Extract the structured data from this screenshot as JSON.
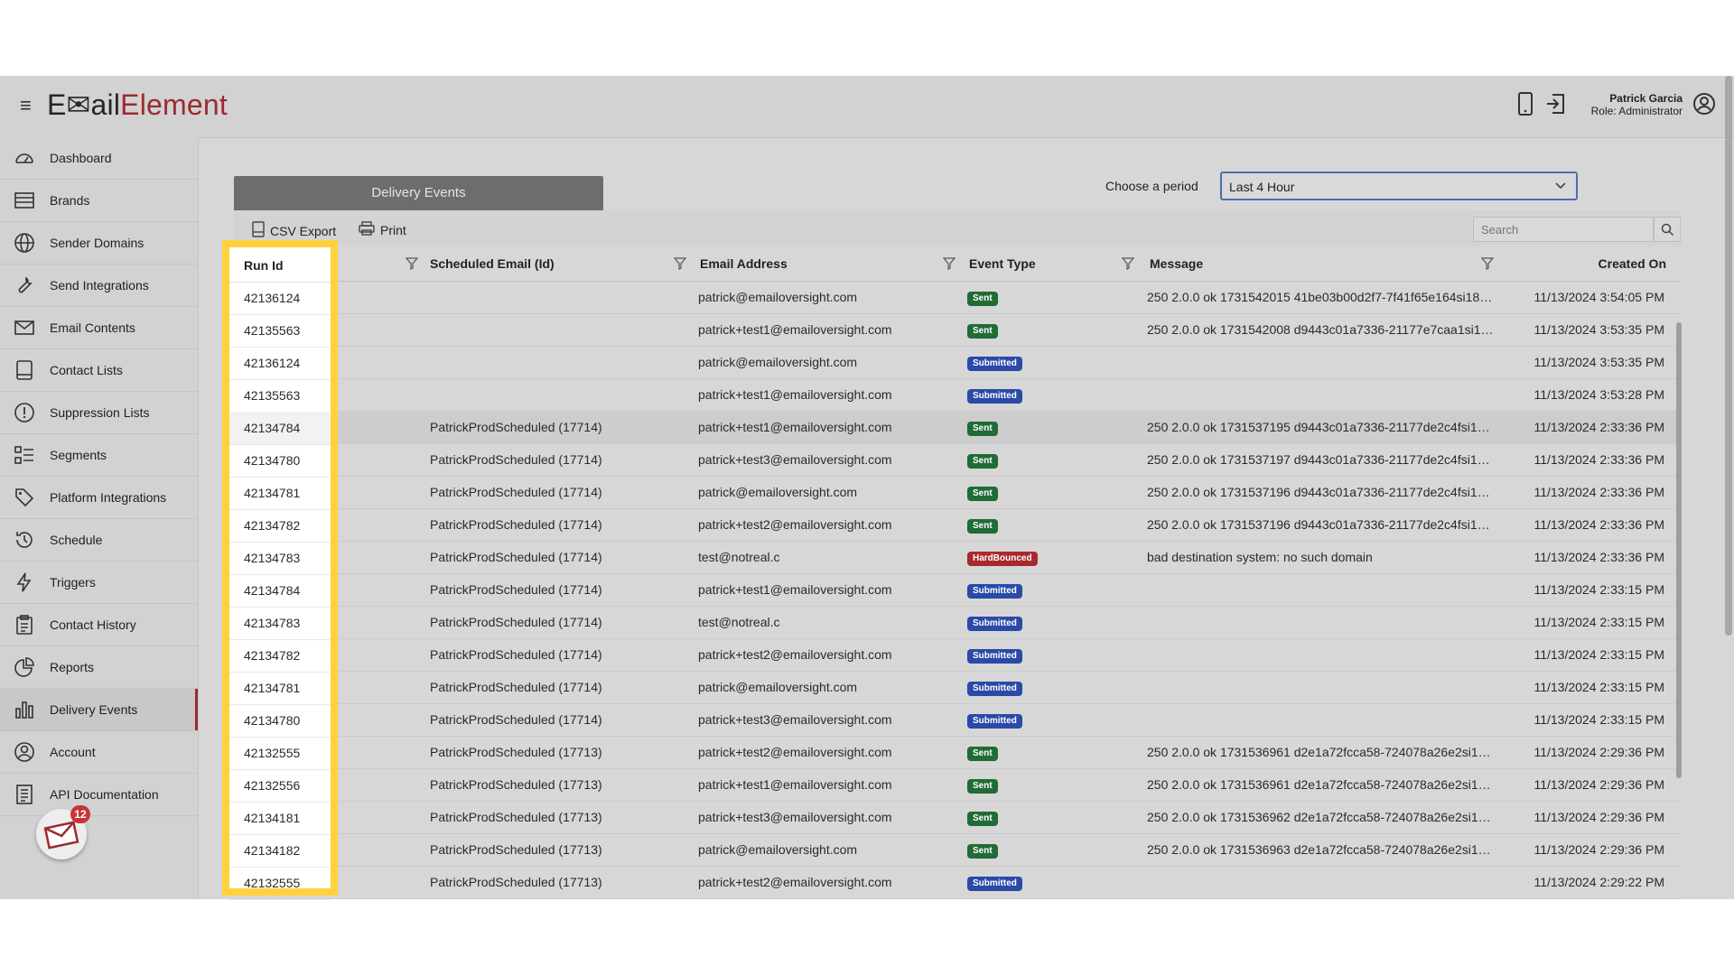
{
  "app": {
    "logo_part1": "E✉ail",
    "logo_part2": "Element"
  },
  "user": {
    "name": "Patrick Garcia",
    "role": "Role: Administrator"
  },
  "sidebar": {
    "items": [
      {
        "label": "Dashboard",
        "icon": "dashboard-icon"
      },
      {
        "label": "Brands",
        "icon": "brands-icon"
      },
      {
        "label": "Sender Domains",
        "icon": "globe-icon"
      },
      {
        "label": "Send Integrations",
        "icon": "wrench-icon"
      },
      {
        "label": "Email Contents",
        "icon": "envelope-icon"
      },
      {
        "label": "Contact Lists",
        "icon": "list-icon"
      },
      {
        "label": "Suppression Lists",
        "icon": "exclamation-icon"
      },
      {
        "label": "Segments",
        "icon": "segments-icon"
      },
      {
        "label": "Platform Integrations",
        "icon": "tag-icon"
      },
      {
        "label": "Schedule",
        "icon": "history-icon"
      },
      {
        "label": "Triggers",
        "icon": "bolt-icon"
      },
      {
        "label": "Contact History",
        "icon": "clipboard-icon"
      },
      {
        "label": "Reports",
        "icon": "pie-chart-icon"
      },
      {
        "label": "Delivery Events",
        "icon": "bar-chart-icon",
        "active": true
      },
      {
        "label": "Account",
        "icon": "user-circle-icon"
      },
      {
        "label": "API Documentation",
        "icon": "document-icon"
      }
    ],
    "notification_count": "12"
  },
  "main": {
    "tab_label": "Delivery Events",
    "period_label": "Choose a period",
    "period_value": "Last 4 Hour",
    "csv_export_label": "CSV Export",
    "print_label": "Print",
    "search_placeholder": "Search"
  },
  "table": {
    "headers": {
      "run_id": "Run Id",
      "scheduled_email": "Scheduled Email (Id)",
      "email_address": "Email Address",
      "event_type": "Event Type",
      "message": "Message",
      "created_on": "Created On"
    },
    "rows": [
      {
        "run_id": "42136124",
        "scheduled": "",
        "email": "patrick@emailoversight.com",
        "event": "Sent",
        "event_class": "sent",
        "message": "250 2.0.0 ok 1731542015 41be03b00d2f7-7f41f65e164si182...",
        "created": "11/13/2024 3:54:05 PM"
      },
      {
        "run_id": "42135563",
        "scheduled": "",
        "email": "patrick+test1@emailoversight.com",
        "event": "Sent",
        "event_class": "sent",
        "message": "250 2.0.0 ok 1731542008 d9443c01a7336-21177e7caa1si19...",
        "created": "11/13/2024 3:53:35 PM"
      },
      {
        "run_id": "42136124",
        "scheduled": "",
        "email": "patrick@emailoversight.com",
        "event": "Submitted",
        "event_class": "submitted",
        "message": "",
        "created": "11/13/2024 3:53:35 PM"
      },
      {
        "run_id": "42135563",
        "scheduled": "",
        "email": "patrick+test1@emailoversight.com",
        "event": "Submitted",
        "event_class": "submitted",
        "message": "",
        "created": "11/13/2024 3:53:28 PM"
      },
      {
        "run_id": "42134784",
        "scheduled": "PatrickProdScheduled (17714)",
        "email": "patrick+test1@emailoversight.com",
        "event": "Sent",
        "event_class": "sent",
        "message": "250 2.0.0 ok 1731537195 d9443c01a7336-21177de2c4fsi17...",
        "created": "11/13/2024 2:33:36 PM",
        "highlight": true
      },
      {
        "run_id": "42134780",
        "scheduled": "PatrickProdScheduled (17714)",
        "email": "patrick+test3@emailoversight.com",
        "event": "Sent",
        "event_class": "sent",
        "message": "250 2.0.0 ok 1731537197 d9443c01a7336-21177de2c4fsi17...",
        "created": "11/13/2024 2:33:36 PM"
      },
      {
        "run_id": "42134781",
        "scheduled": "PatrickProdScheduled (17714)",
        "email": "patrick@emailoversight.com",
        "event": "Sent",
        "event_class": "sent",
        "message": "250 2.0.0 ok 1731537196 d9443c01a7336-21177de2c4fsi17...",
        "created": "11/13/2024 2:33:36 PM"
      },
      {
        "run_id": "42134782",
        "scheduled": "PatrickProdScheduled (17714)",
        "email": "patrick+test2@emailoversight.com",
        "event": "Sent",
        "event_class": "sent",
        "message": "250 2.0.0 ok 1731537196 d9443c01a7336-21177de2c4fsi17...",
        "created": "11/13/2024 2:33:36 PM"
      },
      {
        "run_id": "42134783",
        "scheduled": "PatrickProdScheduled (17714)",
        "email": "test@notreal.c",
        "event": "HardBounced",
        "event_class": "hardbounced",
        "message": "bad destination system: no such domain",
        "created": "11/13/2024 2:33:36 PM"
      },
      {
        "run_id": "42134784",
        "scheduled": "PatrickProdScheduled (17714)",
        "email": "patrick+test1@emailoversight.com",
        "event": "Submitted",
        "event_class": "submitted",
        "message": "",
        "created": "11/13/2024 2:33:15 PM"
      },
      {
        "run_id": "42134783",
        "scheduled": "PatrickProdScheduled (17714)",
        "email": "test@notreal.c",
        "event": "Submitted",
        "event_class": "submitted",
        "message": "",
        "created": "11/13/2024 2:33:15 PM"
      },
      {
        "run_id": "42134782",
        "scheduled": "PatrickProdScheduled (17714)",
        "email": "patrick+test2@emailoversight.com",
        "event": "Submitted",
        "event_class": "submitted",
        "message": "",
        "created": "11/13/2024 2:33:15 PM"
      },
      {
        "run_id": "42134781",
        "scheduled": "PatrickProdScheduled (17714)",
        "email": "patrick@emailoversight.com",
        "event": "Submitted",
        "event_class": "submitted",
        "message": "",
        "created": "11/13/2024 2:33:15 PM"
      },
      {
        "run_id": "42134780",
        "scheduled": "PatrickProdScheduled (17714)",
        "email": "patrick+test3@emailoversight.com",
        "event": "Submitted",
        "event_class": "submitted",
        "message": "",
        "created": "11/13/2024 2:33:15 PM"
      },
      {
        "run_id": "42132555",
        "scheduled": "PatrickProdScheduled (17713)",
        "email": "patrick+test2@emailoversight.com",
        "event": "Sent",
        "event_class": "sent",
        "message": "250 2.0.0 ok 1731536961 d2e1a72fcca58-724078a26e2si192...",
        "created": "11/13/2024 2:29:36 PM"
      },
      {
        "run_id": "42132556",
        "scheduled": "PatrickProdScheduled (17713)",
        "email": "patrick+test1@emailoversight.com",
        "event": "Sent",
        "event_class": "sent",
        "message": "250 2.0.0 ok 1731536961 d2e1a72fcca58-724078a26e2si192...",
        "created": "11/13/2024 2:29:36 PM"
      },
      {
        "run_id": "42134181",
        "scheduled": "PatrickProdScheduled (17713)",
        "email": "patrick+test3@emailoversight.com",
        "event": "Sent",
        "event_class": "sent",
        "message": "250 2.0.0 ok 1731536962 d2e1a72fcca58-724078a26e2si192...",
        "created": "11/13/2024 2:29:36 PM"
      },
      {
        "run_id": "42134182",
        "scheduled": "PatrickProdScheduled (17713)",
        "email": "patrick@emailoversight.com",
        "event": "Sent",
        "event_class": "sent",
        "message": "250 2.0.0 ok 1731536963 d2e1a72fcca58-724078a26e2si192...",
        "created": "11/13/2024 2:29:36 PM"
      },
      {
        "run_id": "42132555",
        "scheduled": "PatrickProdScheduled (17713)",
        "email": "patrick+test2@emailoversight.com",
        "event": "Submitted",
        "event_class": "submitted",
        "message": "",
        "created": "11/13/2024 2:29:22 PM"
      }
    ]
  },
  "colors": {
    "accent": "#9b2b2f",
    "highlight_border": "#ffd13e",
    "sent": "#216b36",
    "submitted": "#2a4aa8",
    "hardbounced": "#a82a2f"
  }
}
